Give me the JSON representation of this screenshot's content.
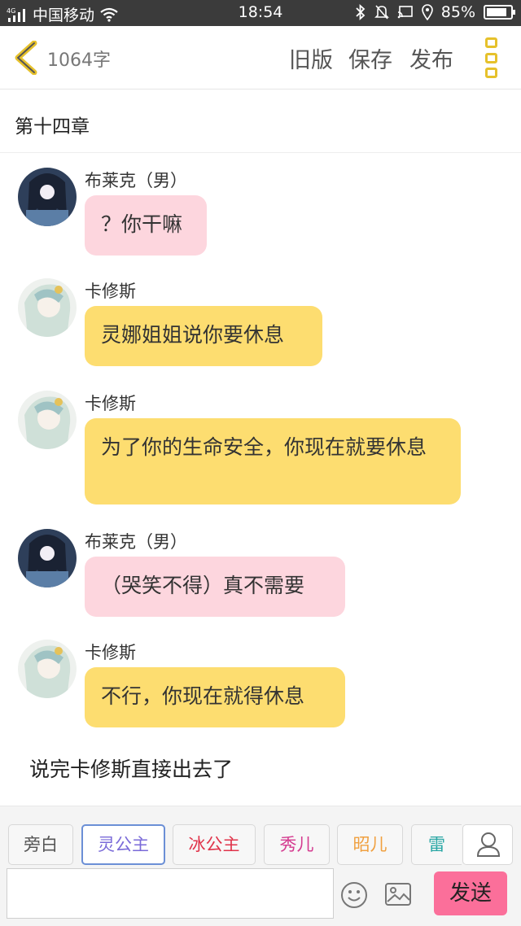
{
  "status_bar": {
    "network": "4G",
    "carrier": "中国移动",
    "time": "18:54",
    "battery": "85%",
    "battery_level": 0.85
  },
  "header": {
    "word_count": "1064字",
    "old_version_label": "旧版",
    "save_label": "保存",
    "publish_label": "发布",
    "accent_color": "#e6c12b"
  },
  "chapter": {
    "title": "第十四章"
  },
  "messages": [
    {
      "sender": "布莱克（男）",
      "text": "？你干嘛",
      "style": "pink"
    },
    {
      "sender": "卡修斯",
      "text": "灵娜姐姐说你要休息",
      "style": "yellow"
    },
    {
      "sender": "卡修斯",
      "text": "为了你的生命安全，你现在就要休息",
      "style": "yellow"
    },
    {
      "sender": "布莱克（男）",
      "text": "（哭笑不得）真不需要",
      "style": "pink"
    },
    {
      "sender": "卡修斯",
      "text": "不行，你现在就得休息",
      "style": "yellow"
    }
  ],
  "narration": "说完卡修斯直接出去了",
  "roles": [
    {
      "label": "旁白",
      "color": "#555555"
    },
    {
      "label": "灵公主",
      "color": "#7a6ad8"
    },
    {
      "label": "冰公主",
      "color": "#e0334a"
    },
    {
      "label": "秀儿",
      "color": "#d43a8f"
    },
    {
      "label": "昭儿",
      "color": "#f0a040"
    },
    {
      "label": "雷伊",
      "color": "#2aa7a5"
    }
  ],
  "composer": {
    "input_value": "",
    "send_label": "发送",
    "send_color": "#fb6f9a"
  }
}
